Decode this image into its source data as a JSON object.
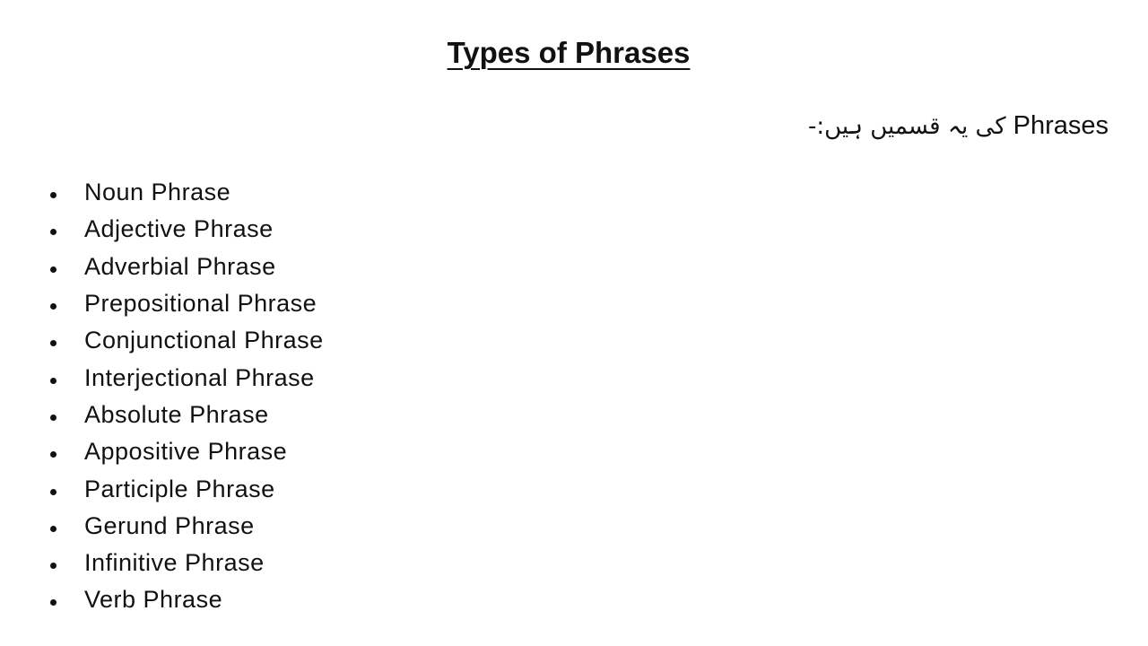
{
  "document": {
    "title": "Types of Phrases",
    "subtitle": {
      "english": "Phrases",
      "urdu": "کی یہ قسمیں ہیں:-"
    },
    "items": [
      "Noun Phrase",
      "Adjective Phrase",
      "Adverbial Phrase",
      "Prepositional Phrase",
      "Conjunctional Phrase",
      "Interjectional Phrase",
      "Absolute Phrase",
      "Appositive Phrase",
      "Participle Phrase",
      "Gerund Phrase",
      "Infinitive Phrase",
      "Verb Phrase"
    ]
  }
}
